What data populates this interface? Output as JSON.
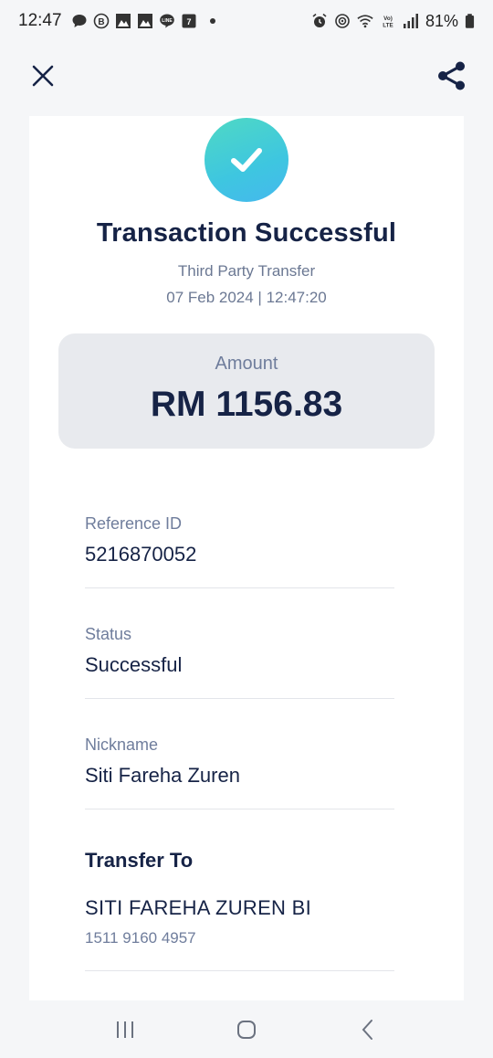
{
  "status_bar": {
    "time": "12:47",
    "battery": "81%",
    "notification_icons": [
      "chat-bubble-icon",
      "b-icon",
      "gallery-icon",
      "gallery-icon",
      "line-icon",
      "calendar-icon"
    ],
    "system_icons": [
      "alarm-icon",
      "hotspot-icon",
      "wifi-icon",
      "volte-icon",
      "signal-icon",
      "battery-icon"
    ]
  },
  "top_bar": {
    "close_icon": "close-icon",
    "share_icon": "share-icon"
  },
  "receipt": {
    "title": "Transaction Successful",
    "subtitle": "Third Party Transfer",
    "datetime": "07 Feb 2024 | 12:47:20",
    "amount_label": "Amount",
    "amount_value": "RM 1156.83",
    "details": [
      {
        "label": "Reference ID",
        "value": "5216870052"
      },
      {
        "label": "Status",
        "value": "Successful"
      },
      {
        "label": "Nickname",
        "value": "Siti Fareha Zuren"
      }
    ],
    "transfer_to": {
      "heading": "Transfer To",
      "account_name": "SITI FAREHA ZUREN BI",
      "account_number": "1511 9160 4957"
    }
  },
  "colors": {
    "primary_text": "#162346",
    "secondary_text": "#6f7d9c",
    "success_gradient_start": "#4fd9c4",
    "success_gradient_end": "#45b8ee",
    "background": "#f5f6f8"
  }
}
